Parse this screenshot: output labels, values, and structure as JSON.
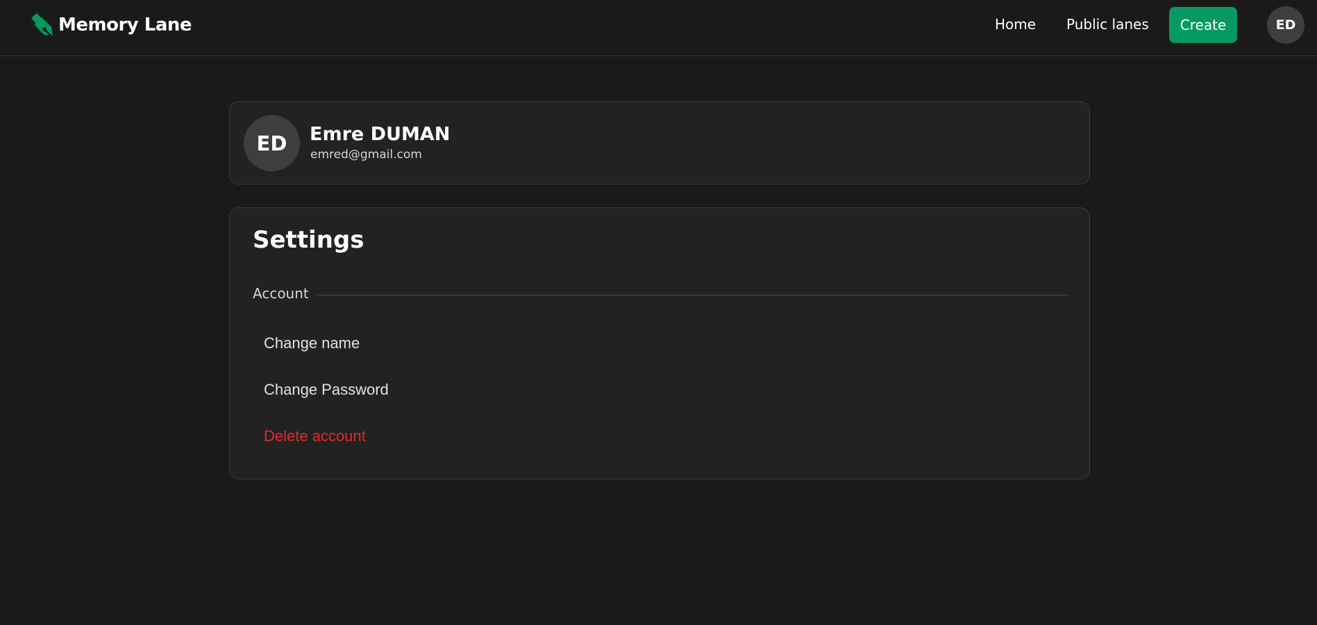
{
  "app": {
    "brand_name": "Memory Lane",
    "brand_icon": "fountain-pen-icon",
    "accent_color": "#069a62"
  },
  "nav": {
    "home_label": "Home",
    "public_lanes_label": "Public lanes",
    "create_label": "Create",
    "avatar_initials": "ED"
  },
  "profile": {
    "initials": "ED",
    "name": "Emre DUMAN",
    "email": "emred@gmail.com"
  },
  "settings": {
    "title": "Settings",
    "section_label": "Account",
    "items": [
      {
        "label": "Change name",
        "color": "#e2e2e2"
      },
      {
        "label": "Change Password",
        "color": "#e2e2e2"
      },
      {
        "label": "Delete account",
        "color": "#e5282d"
      }
    ]
  }
}
